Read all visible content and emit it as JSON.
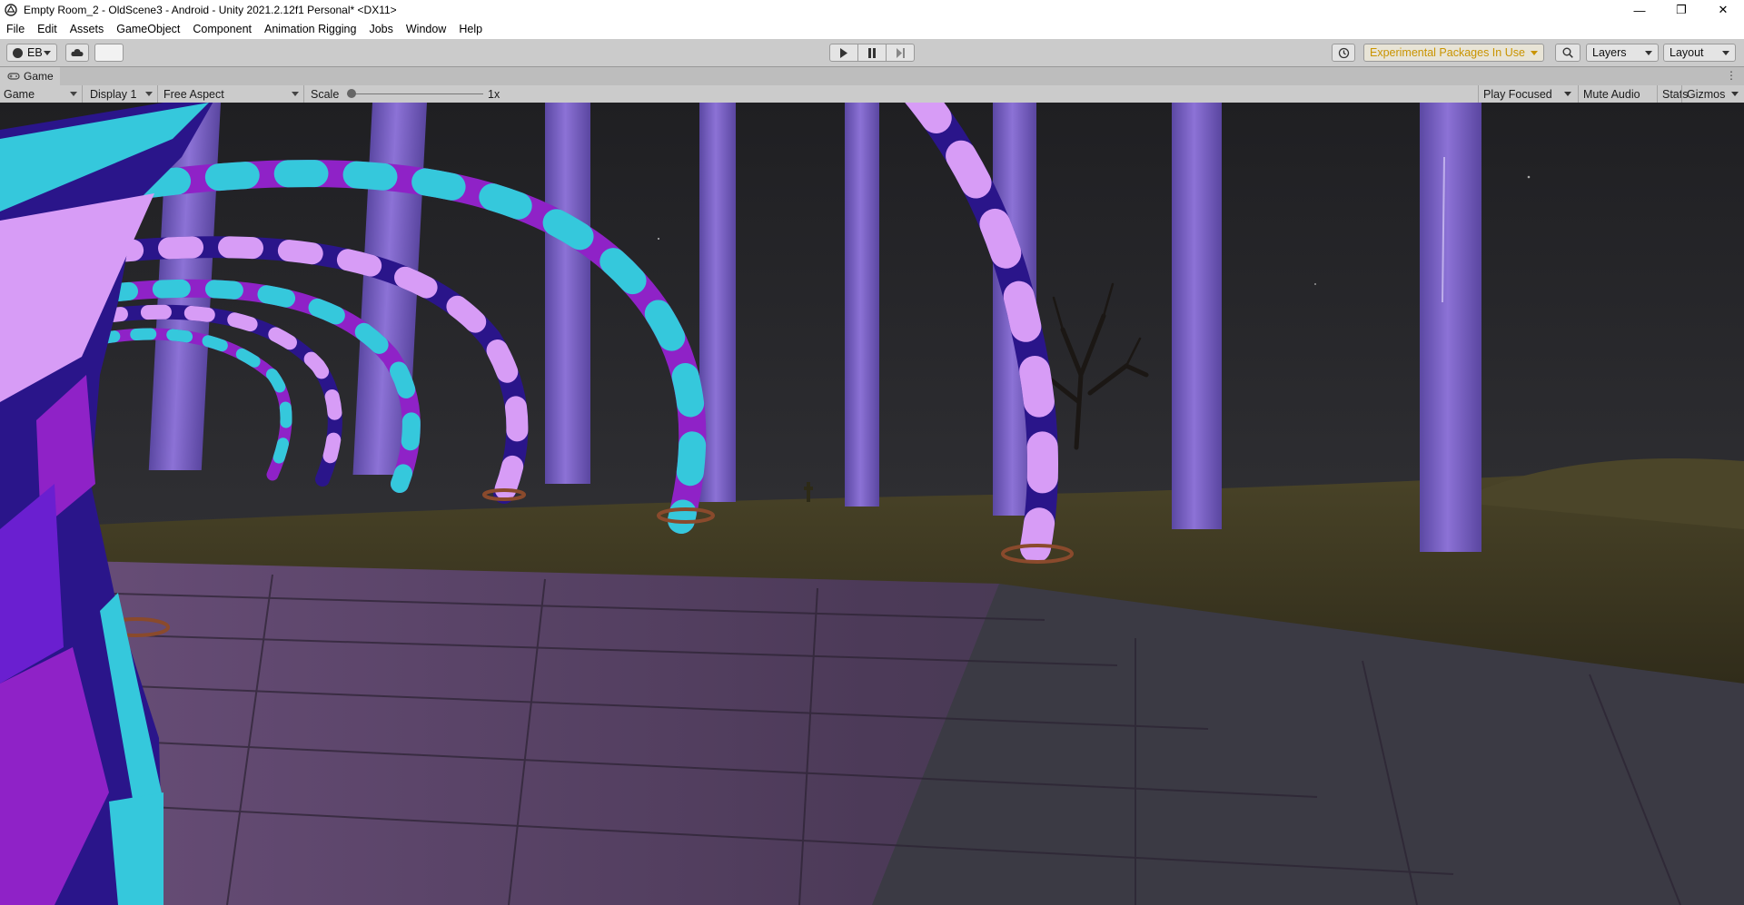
{
  "window": {
    "title": "Empty Room_2 - OldScene3 - Android - Unity 2021.2.12f1 Personal* <DX11>",
    "controls": {
      "minimize": "—",
      "restore": "❐",
      "close": "✕"
    }
  },
  "menu": [
    "File",
    "Edit",
    "Assets",
    "GameObject",
    "Component",
    "Animation Rigging",
    "Jobs",
    "Window",
    "Help"
  ],
  "toolbar": {
    "account_label": "EB",
    "experimental_label": "Experimental Packages In Use",
    "layers_label": "Layers",
    "layout_label": "Layout"
  },
  "panel": {
    "tab_label": "Game",
    "more_icon": "⋮"
  },
  "game_toolbar": {
    "view_mode": "Game",
    "display": "Display 1",
    "aspect": "Free Aspect",
    "scale_label": "Scale",
    "scale_value": "1x",
    "scale_level": 0.0,
    "play_mode": "Play Focused",
    "mute_audio": "Mute Audio",
    "stats": "Stats",
    "gizmos": "Gizmos"
  },
  "colors": {
    "accent_warning": "#c99400",
    "toolbar_bg": "#cbcbcb",
    "night_sky": "#232326",
    "sand": "#3f3a22",
    "pillar": "#7a5fc8",
    "floor": "#4a3c55",
    "cyan": "#35c8dc",
    "violet": "#8f22c7",
    "navy": "#2a158a",
    "lilac": "#d79cf6"
  }
}
